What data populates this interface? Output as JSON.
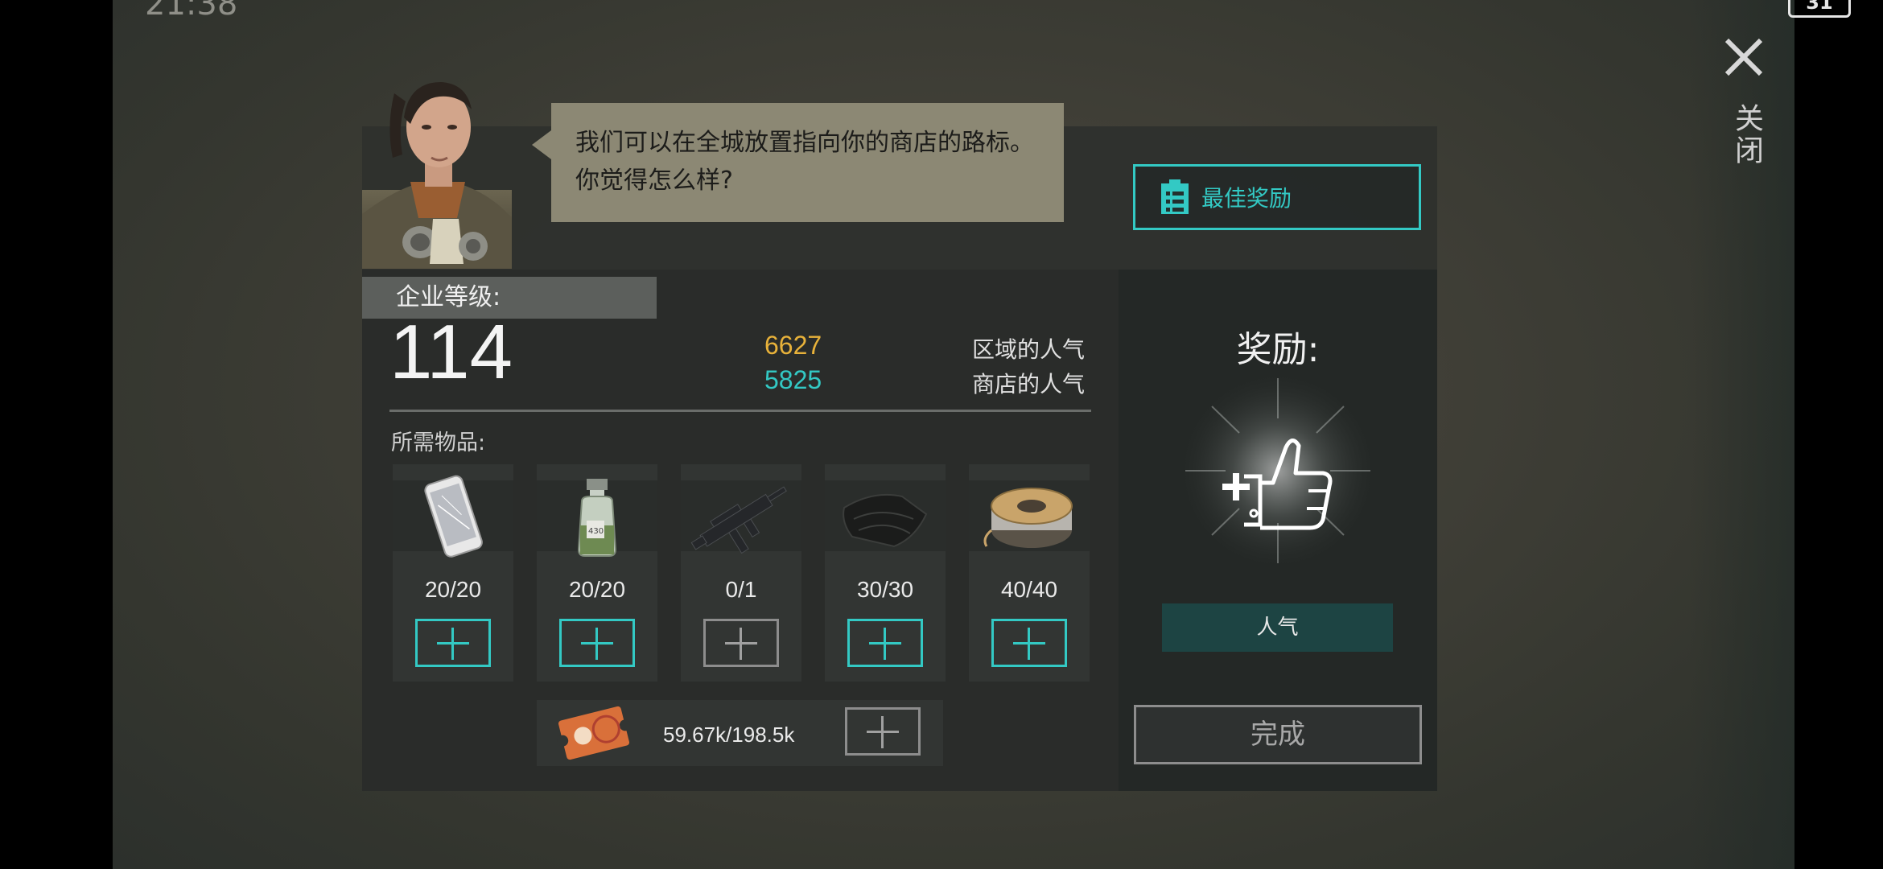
{
  "status_bar": {
    "time": "21:38",
    "battery": "31"
  },
  "close": {
    "label": "关闭"
  },
  "npc": {
    "avatar_icon": "survivor-portrait-icon",
    "speech": "我们可以在全城放置指向你的商店的路标。你觉得怎么样?"
  },
  "best_reward": {
    "label": "最佳奖励",
    "icon": "clipboard-icon"
  },
  "company": {
    "level_label": "企业等级:",
    "level_value": "114",
    "region_popularity": {
      "value": "6627",
      "label": "区域的人气",
      "color": "#e8b23a"
    },
    "shop_popularity": {
      "value": "5825",
      "label": "商店的人气",
      "color": "#33c9c4"
    }
  },
  "required": {
    "title": "所需物品:",
    "items": [
      {
        "icon": "smartphone-icon",
        "count": "20/20",
        "fulfilled": true
      },
      {
        "icon": "chemical-jar-icon",
        "count": "20/20",
        "fulfilled": true
      },
      {
        "icon": "submachine-gun-icon",
        "count": "0/1",
        "fulfilled": false
      },
      {
        "icon": "cloth-icon",
        "count": "30/30",
        "fulfilled": true
      },
      {
        "icon": "wire-spool-icon",
        "count": "40/40",
        "fulfilled": true
      }
    ],
    "coupon": {
      "icon": "coupon-ticket-icon",
      "amount": "59.67k/198.5k",
      "fulfilled": false
    }
  },
  "reward": {
    "title": "奖励:",
    "icon": "popularity-thumbs-up-icon",
    "type_label": "人气"
  },
  "done_button": {
    "label": "完成"
  },
  "colors": {
    "accent": "#33c9c4",
    "gold": "#e8b23a",
    "disabled": "#8d8d8d"
  }
}
